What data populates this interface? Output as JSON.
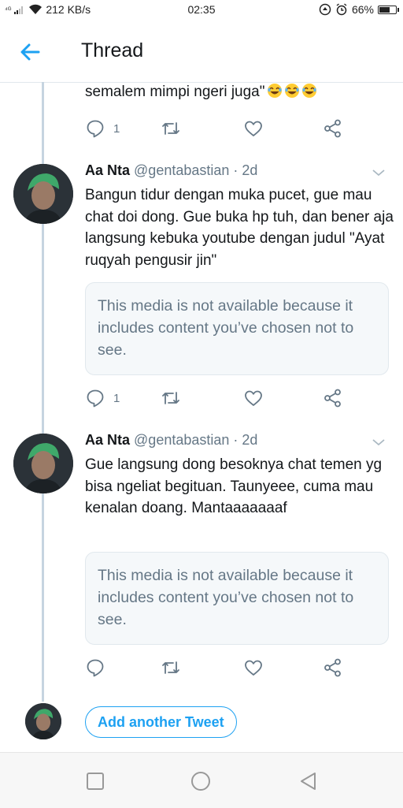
{
  "status_bar": {
    "signal_text": "⁴ᴳ",
    "net_speed": "212 KB/s",
    "time": "02:35",
    "battery_text": "66%",
    "battery_level": 0.66
  },
  "app_bar": {
    "title": "Thread",
    "back_icon": "arrow-left-icon"
  },
  "partial_tweet": {
    "text": "semalem mimpi ngeri juga\"",
    "emojis": [
      "face-with-tears-of-joy",
      "face-with-tears-of-joy",
      "face-with-tears-of-joy"
    ],
    "reply_count": "1"
  },
  "tweets": [
    {
      "name": "Aa Nta",
      "handle": "@gentabastian · 2d",
      "text": "Bangun tidur dengan muka pucet, gue mau chat doi dong. Gue buka hp tuh, dan bener aja langsung kebuka youtube dengan judul \"Ayat ruqyah pengusir jin\"",
      "media_notice": "This media is not available because it includes content you’ve chosen not to see.",
      "reply_count": "1"
    },
    {
      "name": "Aa Nta",
      "handle": "@gentabastian · 2d",
      "text": "Gue langsung dong besoknya chat temen yg bisa ngeliat begituan. Taunyeee, cuma mau kenalan doang. Mantaaaaaaaf",
      "media_notice": "This media is not available because it includes content you’ve chosen not to see.",
      "reply_count": ""
    }
  ],
  "add_tweet": {
    "label": "Add another Tweet"
  },
  "colors": {
    "accent": "#1da1f2",
    "text": "#14171a",
    "secondary": "#657786",
    "thread_line": "#c6d4e0"
  }
}
